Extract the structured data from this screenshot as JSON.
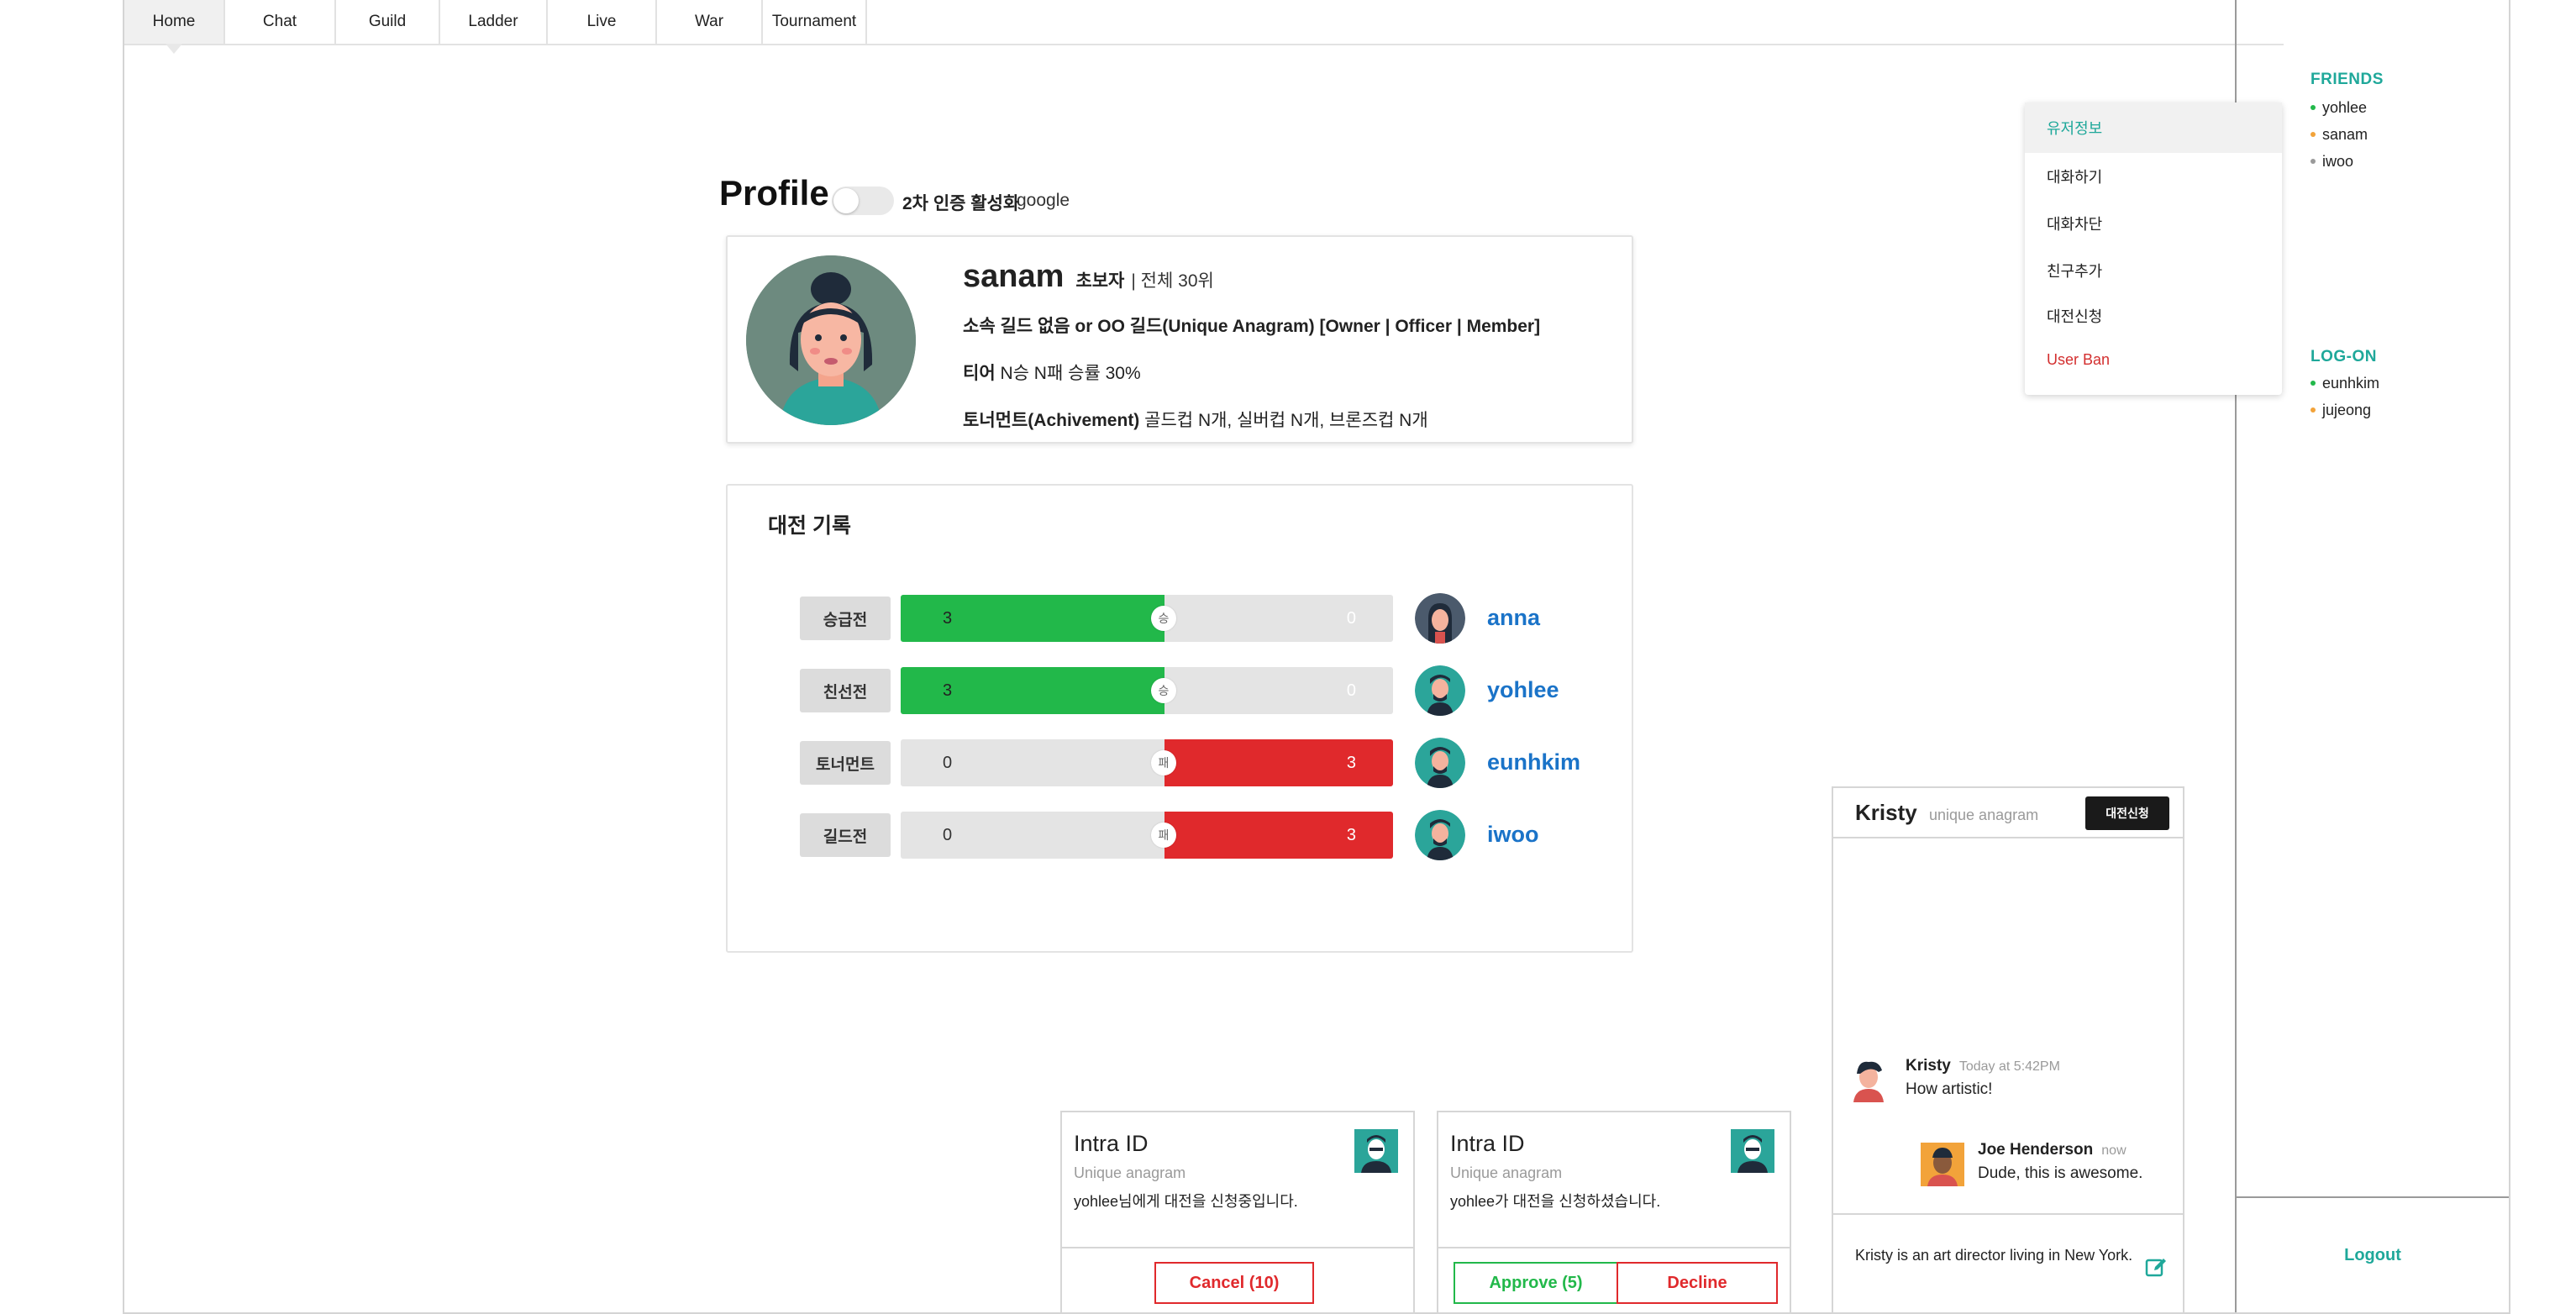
{
  "nav": {
    "tabs": [
      {
        "label": "Home"
      },
      {
        "label": "Chat"
      },
      {
        "label": "Guild"
      },
      {
        "label": "Ladder"
      },
      {
        "label": "Live"
      },
      {
        "label": "War"
      },
      {
        "label": "Tournament"
      }
    ],
    "active_tab": "Home"
  },
  "sidebar": {
    "friends_title": "FRIENDS",
    "friends": [
      {
        "name": "yohlee",
        "status_color": "#22b84a"
      },
      {
        "name": "sanam",
        "status_color": "#f2a33a"
      },
      {
        "name": "iwoo",
        "status_color": "#9a9a9a"
      }
    ],
    "logon_title": "LOG-ON",
    "logon": [
      {
        "name": "eunhkim",
        "status_color": "#22b84a"
      },
      {
        "name": "jujeong",
        "status_color": "#f2a33a"
      }
    ],
    "logout_label": "Logout"
  },
  "context_menu": {
    "items": [
      {
        "label": "유저정보"
      },
      {
        "label": "대화하기"
      },
      {
        "label": "대화차단"
      },
      {
        "label": "친구추가"
      },
      {
        "label": "대전신청"
      },
      {
        "label": "User Ban"
      }
    ]
  },
  "profile": {
    "heading": "Profile",
    "twofa_label": "2차 인증 활성화",
    "twofa_provider": "google",
    "twofa_enabled": false,
    "name": "sanam",
    "level": "초보자",
    "rank": "| 전체 30위",
    "guild_line": "소속 길드 없음 or OO 길드(Unique Anagram) [Owner | Officer | Member]",
    "tier_label": "티어",
    "tier_value": "N승 N패 승률 30%",
    "achievement_label": "토너먼트(Achivement)",
    "achievement_value": "골드컵 N개, 실버컵 N개, 브론즈컵 N개"
  },
  "match_history": {
    "title": "대전 기록",
    "rows": [
      {
        "type": "승급전",
        "my_score": "3",
        "opp_score": "0",
        "badge": "승",
        "result": "win",
        "opponent": "anna"
      },
      {
        "type": "친선전",
        "my_score": "3",
        "opp_score": "0",
        "badge": "승",
        "result": "win",
        "opponent": "yohlee"
      },
      {
        "type": "토너먼트",
        "my_score": "0",
        "opp_score": "3",
        "badge": "패",
        "result": "lose",
        "opponent": "eunhkim"
      },
      {
        "type": "길드전",
        "my_score": "0",
        "opp_score": "3",
        "badge": "패",
        "result": "lose",
        "opponent": "iwoo"
      }
    ]
  },
  "chat": {
    "name": "Kristy",
    "subtitle": "unique anagram",
    "challenge_button": "대전신청",
    "messages": [
      {
        "author": "Kristy",
        "time": "Today at 5:42PM",
        "text": "How artistic!"
      },
      {
        "author": "Joe Henderson",
        "time": "now",
        "text": "Dude, this is awesome."
      }
    ],
    "footer_text": "Kristy is an art director living in New York."
  },
  "requests": [
    {
      "title": "Intra ID",
      "subtitle": "Unique anagram",
      "text": "yohlee님에게 대전을 신청중입니다.",
      "cancel_label": "Cancel (10)"
    },
    {
      "title": "Intra ID",
      "subtitle": "Unique anagram",
      "text": "yohlee가 대전을 신청하셨습니다.",
      "approve_label": "Approve (5)",
      "decline_label": "Decline"
    }
  ],
  "colors": {
    "accent": "#1fa89a",
    "win": "#22b84a",
    "lose": "#e0292c",
    "link": "#1a73c8"
  }
}
